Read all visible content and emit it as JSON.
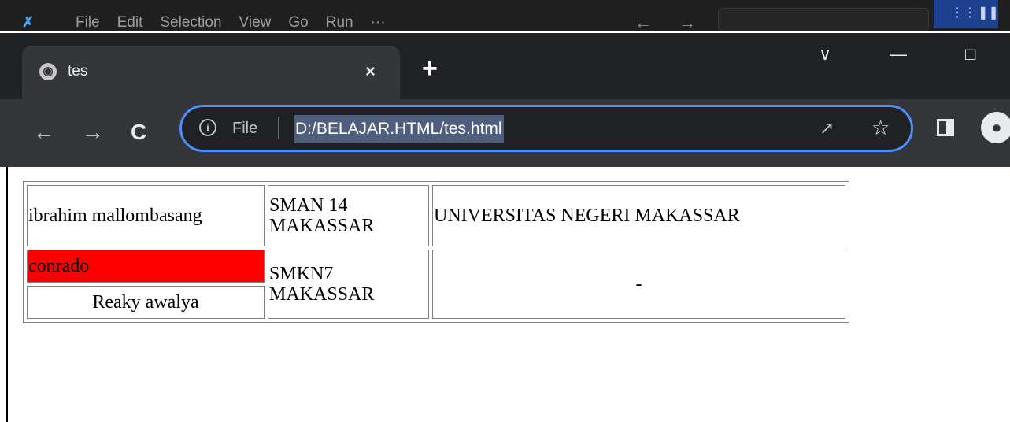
{
  "vscode": {
    "menu": [
      "File",
      "Edit",
      "Selection",
      "View",
      "Go",
      "Run",
      "···"
    ],
    "nav_arrows": "← →"
  },
  "browser": {
    "tab": {
      "title": "tes",
      "close": "×"
    },
    "new_tab": "+",
    "window_controls": {
      "tabs_menu": "∨",
      "minimize": "—",
      "maximize": "□"
    },
    "nav": {
      "back": "←",
      "forward": "→",
      "reload": "C"
    },
    "omnibox": {
      "scheme_label": "File",
      "url": "D:/BELAJAR.HTML/tes.html",
      "info": "i"
    }
  },
  "page": {
    "table": {
      "r1": {
        "c1": "ibrahim mallombasang",
        "c2": "SMAN 14 MAKASSAR",
        "c3": "UNIVERSITAS NEGERI MAKASSAR"
      },
      "r2": {
        "c1": "conrado",
        "c2": "SMKN7 MAKASSAR",
        "c3": "-"
      },
      "r3": {
        "c1": "Reaky awalya"
      }
    }
  },
  "colors": {
    "accent_focus": "#4d8ef8",
    "url_highlight": "#4e5e7c",
    "cell_highlight": "#ff0000"
  }
}
